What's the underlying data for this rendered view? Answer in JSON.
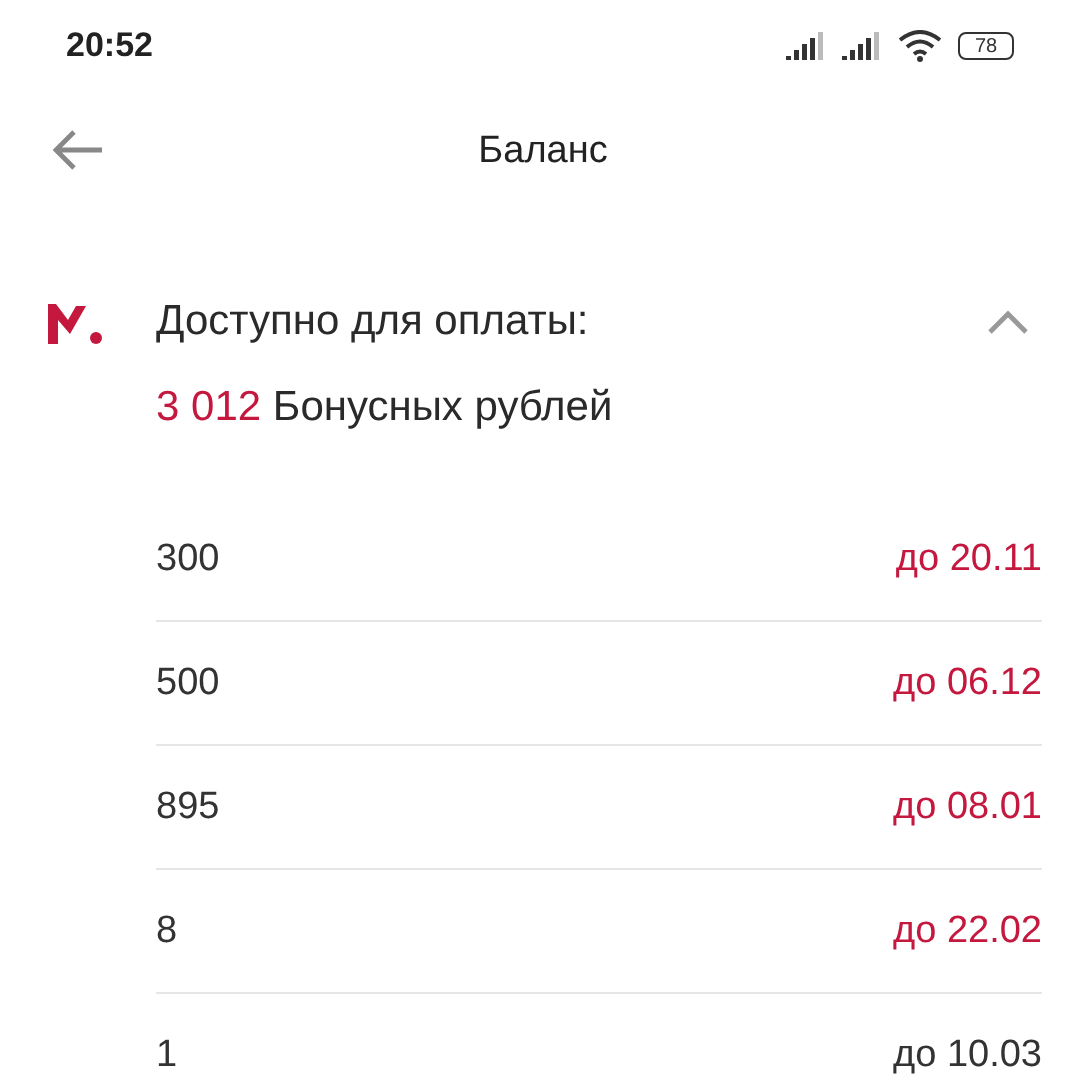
{
  "status_bar": {
    "time": "20:52",
    "battery": "78"
  },
  "header": {
    "title": "Баланс"
  },
  "balance": {
    "label": "Доступно для оплаты:",
    "amount": "3 012",
    "unit": "Бонусных рублей",
    "expanded": true
  },
  "rows": [
    {
      "amount": "300",
      "expiry": "до 20.11",
      "soon": true
    },
    {
      "amount": "500",
      "expiry": "до 06.12",
      "soon": true
    },
    {
      "amount": "895",
      "expiry": "до 08.01",
      "soon": true
    },
    {
      "amount": "8",
      "expiry": "до 22.02",
      "soon": true
    },
    {
      "amount": "1",
      "expiry": "до 10.03",
      "soon": false
    }
  ]
}
